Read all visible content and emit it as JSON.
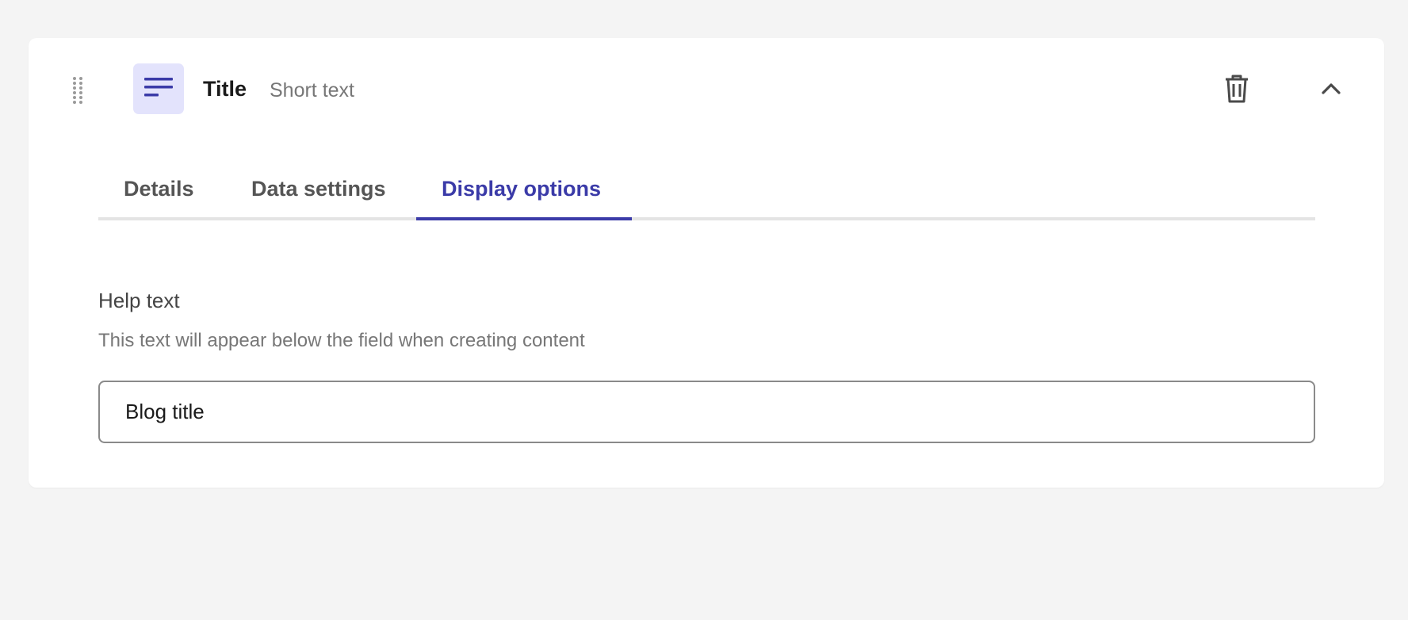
{
  "field": {
    "name": "Title",
    "type": "Short text",
    "icon": "text-lines-icon"
  },
  "actions": {
    "delete_icon": "trash-icon",
    "collapse_icon": "chevron-up-icon"
  },
  "tabs": [
    {
      "label": "Details",
      "active": false
    },
    {
      "label": "Data settings",
      "active": false
    },
    {
      "label": "Display options",
      "active": true
    }
  ],
  "help_text": {
    "label": "Help text",
    "description": "This text will appear below the field when creating content",
    "value": "Blog title"
  },
  "colors": {
    "accent": "#3b3ba8",
    "icon_bg": "#e3e3fc",
    "page_bg": "#f4f4f4"
  }
}
